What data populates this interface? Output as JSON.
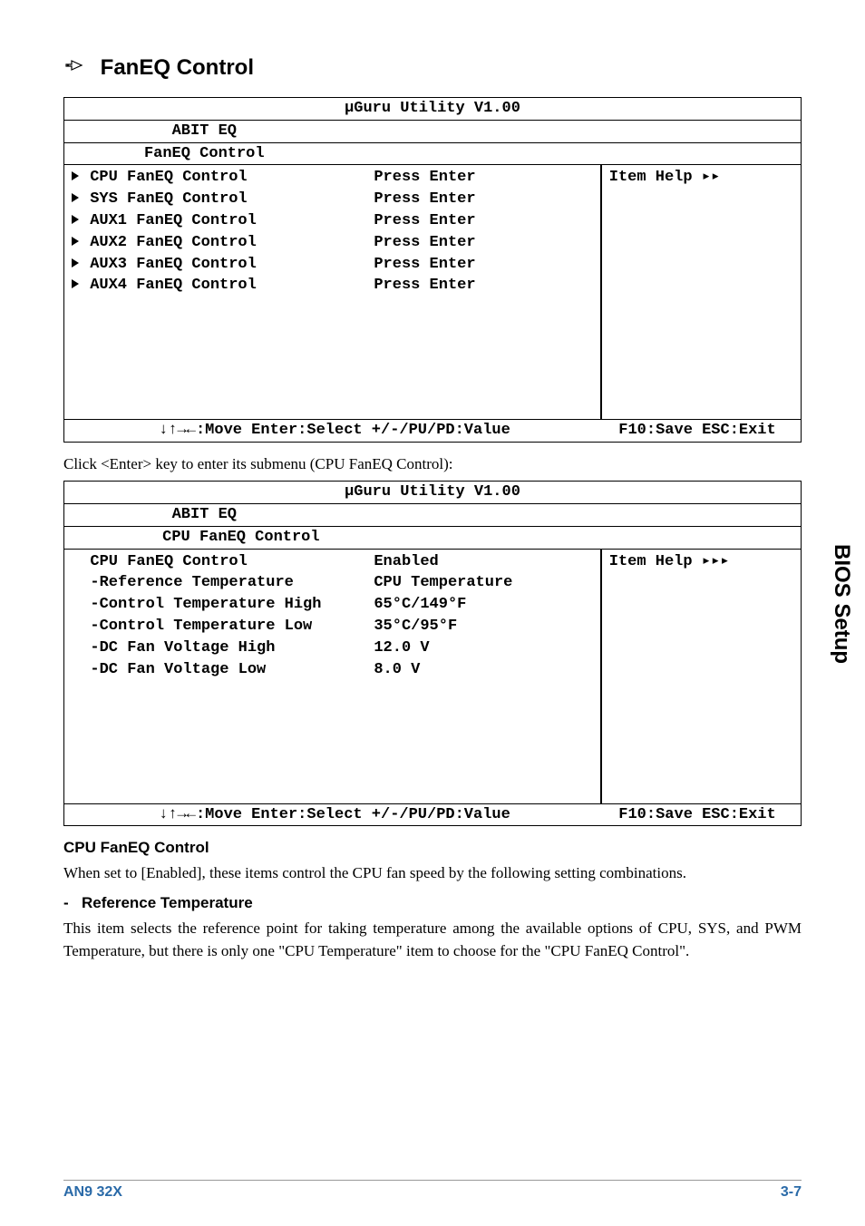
{
  "section": {
    "title": "FanEQ Control",
    "hand": "SVG"
  },
  "bios1": {
    "title": "µGuru Utility V1.00",
    "abit": "ABIT EQ",
    "sub": "FanEQ Control",
    "rows": [
      {
        "name": "CPU FanEQ Control",
        "val": "Press Enter"
      },
      {
        "name": "SYS FanEQ Control",
        "val": "Press Enter"
      },
      {
        "name": "AUX1 FanEQ Control",
        "val": "Press Enter"
      },
      {
        "name": "AUX2 FanEQ Control",
        "val": "Press Enter"
      },
      {
        "name": "AUX3 FanEQ Control",
        "val": "Press Enter"
      },
      {
        "name": "AUX4 FanEQ Control",
        "val": "Press Enter"
      }
    ],
    "help": "Item Help ▸▸",
    "footLeft": "↓↑→←:Move  Enter:Select  +/-/PU/PD:Value",
    "footRight": "F10:Save  ESC:Exit"
  },
  "caption": "Click <Enter> key to enter its submenu (CPU FanEQ Control):",
  "bios2": {
    "title": "µGuru Utility V1.00",
    "abit": "ABIT EQ",
    "sub": "CPU FanEQ Control",
    "rows": [
      {
        "name": "CPU FanEQ Control",
        "val": "Enabled"
      },
      {
        "name": "-Reference Temperature",
        "val": "CPU Temperature"
      },
      {
        "name": "-Control Temperature High",
        "val": "65°C/149°F"
      },
      {
        "name": "-Control Temperature Low",
        "val": "35°C/95°F"
      },
      {
        "name": "-DC Fan Voltage High",
        "val": "12.0 V"
      },
      {
        "name": "-DC Fan Voltage Low",
        "val": "8.0 V"
      }
    ],
    "help": "Item Help ▸▸▸",
    "footLeft": "↓↑→←:Move  Enter:Select  +/-/PU/PD:Value",
    "footRight": "F10:Save  ESC:Exit"
  },
  "cpu_heading": "CPU FanEQ Control",
  "cpu_body": "When set to [Enabled], these items control the CPU fan speed by the following setting combinations.",
  "ref_heading": "Reference Temperature",
  "ref_body": "This item selects the reference point for taking temperature among the available options of CPU, SYS, and PWM Temperature, but there is only one \"CPU Temperature\" item to choose for the \"CPU FanEQ Control\".",
  "side_tab": "BIOS Setup",
  "footer": {
    "left": "AN9 32X",
    "right": "3-7"
  }
}
